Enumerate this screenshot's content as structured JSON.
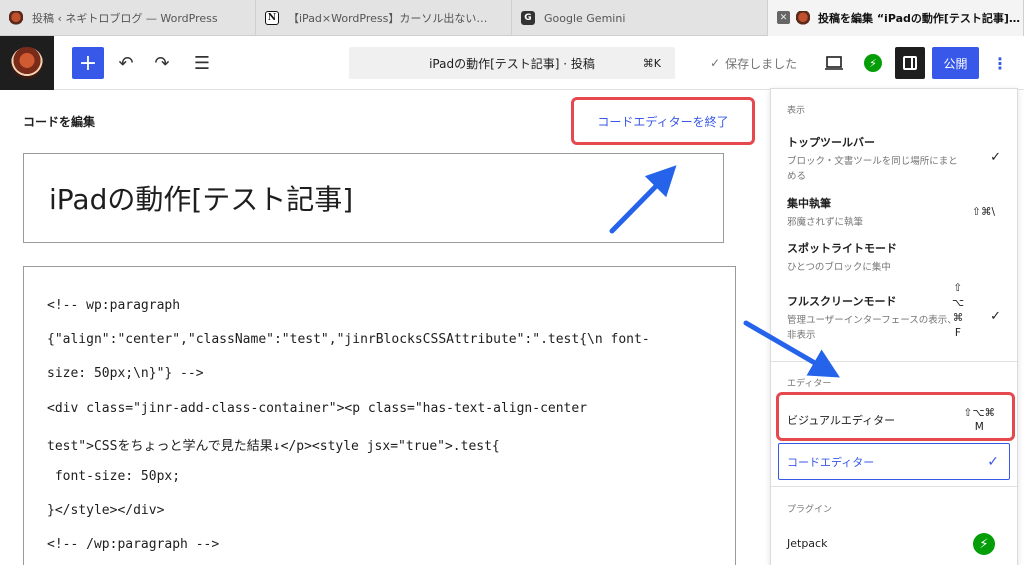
{
  "browser": {
    "tabs": [
      {
        "title": "投稿 ‹ ネギトロブログ — WordPress",
        "icon": "blog-favicon-icon"
      },
      {
        "title": "【iPad×WordPress】カーソル出ない…",
        "icon": "notion-icon",
        "icon_text": "N"
      },
      {
        "title": "Google Gemini",
        "icon": "gemini-icon",
        "icon_text": "G"
      },
      {
        "title": "投稿を編集 “iPadの動作[テスト記事]…",
        "icon": "blog-favicon-icon",
        "close": "✕"
      }
    ]
  },
  "toolbar": {
    "add_icon": "+",
    "undo_icon": "↶",
    "redo_icon": "↷",
    "list_icon": "☰",
    "document_title": "iPadの動作[テスト記事] · 投稿",
    "command_shortcut": "⌘K",
    "saved_check": "✓",
    "saved_label": "保存しました",
    "preview_icon": "▭",
    "jetpack_icon": "⚡",
    "publish_label": "公開",
    "more_icon": "⋮"
  },
  "editor": {
    "code_editor_heading": "コードを編集",
    "exit_code_editor": "コードエディターを終了",
    "post_title": "iPadの動作[テスト記事]",
    "code_lines": [
      "<!-- wp:paragraph",
      "{\"align\":\"center\",\"className\":\"test\",\"jinrBlocksCSSAttribute\":\".test{\\n font-",
      "size: 50px;\\n}\"} -->",
      "<div class=\"jinr-add-class-container\"><p class=\"has-text-align-center",
      "test\">CSSをちょっと学んで見た結果↓</p><style jsx=\"true\">.test{",
      " font-size: 50px;",
      "}</style></div>",
      "<!-- /wp:paragraph -->"
    ]
  },
  "menu": {
    "view_label": "表示",
    "view_items": [
      {
        "title": "トップツールバー",
        "desc": "ブロック・文書ツールを同じ場所にまとめる",
        "checked": "✓",
        "shortcut": ""
      },
      {
        "title": "集中執筆",
        "desc": "邪魔されずに執筆",
        "checked": "",
        "shortcut": "⇧⌘\\"
      },
      {
        "title": "スポットライトモード",
        "desc": "ひとつのブロックに集中",
        "checked": "",
        "shortcut": ""
      },
      {
        "title": "フルスクリーンモード",
        "desc": "管理ユーザーインターフェースの表示、非表示",
        "checked": "✓",
        "shortcut": "⇧\n⌥\n⌘\nF"
      }
    ],
    "editor_label": "エディター",
    "visual_editor": {
      "title": "ビジュアルエディター",
      "shortcut": "⇧⌥⌘\nM"
    },
    "code_editor": {
      "title": "コードエディター",
      "checked": "✓"
    },
    "plugins_label": "プラグイン",
    "jetpack": {
      "title": "Jetpack",
      "icon": "⚡"
    }
  },
  "colors": {
    "accent": "#3858e9",
    "highlight": "#e5484d",
    "arrow": "#2563eb",
    "jetpack": "#069e08"
  }
}
